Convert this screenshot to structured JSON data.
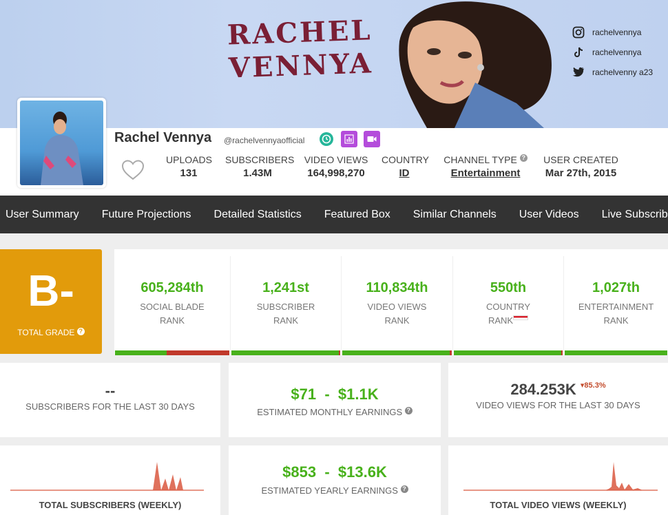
{
  "banner": {
    "title_line1": "RACHEL",
    "title_line2": "VENNYA",
    "socials": [
      {
        "icon": "instagram-icon",
        "handle": "rachelvennya"
      },
      {
        "icon": "tiktok-icon",
        "handle": "rachelvennya"
      },
      {
        "icon": "twitter-icon",
        "handle": "rachelvenny a23"
      }
    ]
  },
  "profile": {
    "name": "Rachel Vennya",
    "handle": "@rachelvennyaofficial",
    "badges": [
      {
        "icon": "clock-icon",
        "color": "#26b69a"
      },
      {
        "icon": "bar-chart-icon",
        "color": "#b44cdb"
      },
      {
        "icon": "video-camera-icon",
        "color": "#b44cdb"
      }
    ],
    "stats": {
      "uploads_label": "UPLOADS",
      "uploads": "131",
      "subscribers_label": "SUBSCRIBERS",
      "subscribers": "1.43M",
      "views_label": "VIDEO VIEWS",
      "views": "164,998,270",
      "country_label": "COUNTRY",
      "country": "ID",
      "type_label": "CHANNEL TYPE",
      "type": "Entertainment",
      "created_label": "USER CREATED",
      "created": "Mar 27th, 2015"
    }
  },
  "nav": [
    "User Summary",
    "Future Projections",
    "Detailed Statistics",
    "Featured Box",
    "Similar Channels",
    "User Videos",
    "Live Subscribe"
  ],
  "grade": {
    "letter": "B-",
    "label": "TOTAL GRADE",
    "color": "#e29b0b"
  },
  "ranks": [
    {
      "value": "605,284th",
      "line1": "SOCIAL BLADE",
      "line2": "RANK",
      "green_fraction": 0.45
    },
    {
      "value": "1,241st",
      "line1": "SUBSCRIBER",
      "line2": "RANK",
      "green_fraction": 0.99
    },
    {
      "value": "110,834th",
      "line1": "VIDEO VIEWS",
      "line2": "RANK",
      "green_fraction": 0.98
    },
    {
      "value": "550th",
      "line1": "COUNTRY",
      "line2": "RANK",
      "green_fraction": 0.99
    },
    {
      "value": "1,027th",
      "line1": "ENTERTAINMENT",
      "line2": "RANK",
      "green_fraction": 1.0
    }
  ],
  "cards": {
    "subs30_value": "--",
    "subs30_label": "SUBSCRIBERS FOR THE LAST 30 DAYS",
    "monthly_low": "$71",
    "monthly_high": "$1.1K",
    "monthly_label": "ESTIMATED MONTHLY EARNINGS",
    "views30_value": "284.253K",
    "views30_change": "▾85.3%",
    "views30_label": "VIDEO VIEWS FOR THE LAST 30 DAYS",
    "weekly_subs_label": "TOTAL SUBSCRIBERS (WEEKLY)",
    "yearly_low": "$853",
    "yearly_high": "$13.6K",
    "yearly_label": "ESTIMATED YEARLY EARNINGS",
    "weekly_views_label": "TOTAL VIDEO VIEWS (WEEKLY)"
  },
  "colors": {
    "green": "#48b11b",
    "red": "#c0392b",
    "nav_bg": "#333333",
    "spark": "#d9583f"
  }
}
